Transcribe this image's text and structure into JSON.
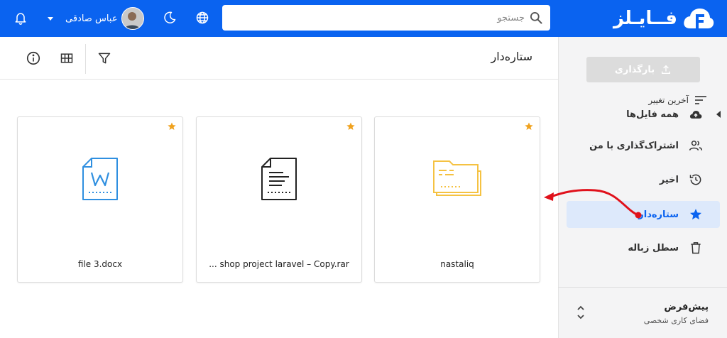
{
  "header": {
    "logo_text": "فــایـلز",
    "search_placeholder": "جستجو",
    "user_name": "عباس صادقی"
  },
  "sidebar": {
    "upload_label": "بارگذاری",
    "items": [
      {
        "label": "همه فایل‌ها",
        "icon": "cloud-upload-icon"
      },
      {
        "label": "اشتراک‌گذاری با من",
        "icon": "people-icon"
      },
      {
        "label": "اخیر",
        "icon": "history-icon"
      },
      {
        "label": "ستاره‌دار",
        "icon": "star-icon",
        "active": true
      },
      {
        "label": "سطل زباله",
        "icon": "trash-icon"
      }
    ],
    "workspace": {
      "title": "پیش‌فرض",
      "subtitle": "فضای کاری شخصی"
    }
  },
  "main": {
    "title": "ستاره‌دار",
    "sort_label": "آخرین تغییر",
    "files": [
      {
        "name": "nastaliq",
        "type": "folder",
        "starred": true
      },
      {
        "name": "shop project laravel – Copy.rar ...",
        "type": "archive",
        "starred": true
      },
      {
        "name": "file 3.docx",
        "type": "word",
        "starred": true
      }
    ]
  },
  "colors": {
    "brand": "#0a63f0",
    "star": "#f0a21e",
    "folder": "#f5c242",
    "word": "#2f8fe0",
    "annotation": "#e0111b"
  }
}
